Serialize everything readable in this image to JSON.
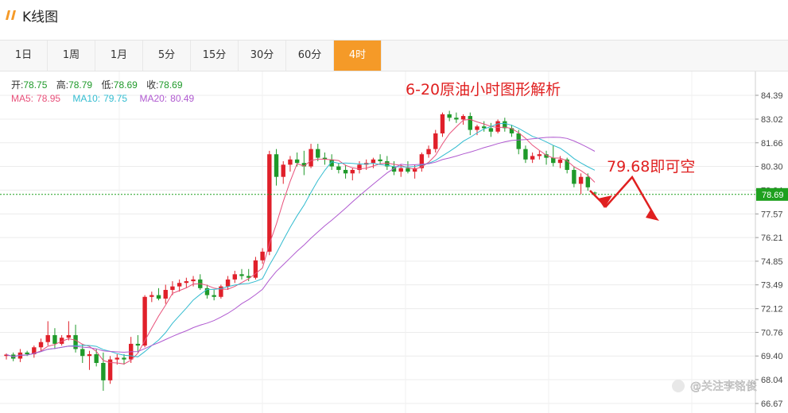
{
  "app": {
    "title": "K线图",
    "logo_icon": "orange-slash-bars-icon"
  },
  "tabs": [
    {
      "label": "1日",
      "active": false
    },
    {
      "label": "1周",
      "active": false
    },
    {
      "label": "1月",
      "active": false
    },
    {
      "label": "5分",
      "active": false
    },
    {
      "label": "15分",
      "active": false
    },
    {
      "label": "30分",
      "active": false
    },
    {
      "label": "60分",
      "active": false
    },
    {
      "label": "4时",
      "active": true
    }
  ],
  "colors": {
    "accent": "#f59a28",
    "up": "#e0202a",
    "down": "#1f9a2a",
    "ma5": "#e8507a",
    "ma10": "#33bcd0",
    "ma20": "#b05ad0",
    "annotation": "#e02020",
    "current_line": "#1fa01f"
  },
  "ohlc": {
    "open_label": "开:",
    "open": "78.75",
    "high_label": "高:",
    "high": "78.79",
    "low_label": "低:",
    "low": "78.69",
    "close_label": "收:",
    "close": "78.69"
  },
  "ma": {
    "ma5_label": "MA5:",
    "ma5": "78.95",
    "ma10_label": "MA10:",
    "ma10": "79.75",
    "ma20_label": "MA20:",
    "ma20": "80.49"
  },
  "annotations": {
    "headline": "6-20原油小时图形解析",
    "signal": "79.68即可空"
  },
  "watermark": "关注李铭俊",
  "chart_data": {
    "type": "candlestick",
    "current_price": 78.69,
    "current_price_label": "78.69",
    "y_ticks": [
      "84.39",
      "83.02",
      "81.66",
      "80.30",
      "78.94",
      "77.57",
      "76.21",
      "74.85",
      "73.49",
      "72.12",
      "70.76",
      "69.40",
      "68.04",
      "66.67"
    ],
    "ylim": [
      66.67,
      84.39
    ],
    "series_names": [
      "MA5",
      "MA10",
      "MA20"
    ],
    "candles": [
      [
        69.4,
        69.55,
        69.2,
        69.48
      ],
      [
        69.48,
        69.6,
        69.1,
        69.25
      ],
      [
        69.25,
        69.8,
        69.05,
        69.6
      ],
      [
        69.6,
        69.7,
        69.4,
        69.5
      ],
      [
        69.5,
        70.0,
        69.3,
        69.9
      ],
      [
        69.9,
        70.4,
        69.7,
        70.2
      ],
      [
        70.2,
        71.4,
        70.0,
        70.6
      ],
      [
        70.6,
        71.0,
        69.8,
        70.1
      ],
      [
        70.1,
        70.6,
        70.0,
        70.45
      ],
      [
        70.45,
        71.4,
        70.3,
        70.6
      ],
      [
        70.6,
        71.2,
        69.6,
        69.8
      ],
      [
        69.8,
        70.1,
        69.0,
        69.4
      ],
      [
        69.4,
        69.7,
        68.6,
        69.5
      ],
      [
        69.5,
        69.8,
        68.8,
        69.0
      ],
      [
        69.0,
        69.6,
        67.4,
        68.0
      ],
      [
        68.0,
        69.4,
        67.8,
        69.2
      ],
      [
        69.2,
        69.5,
        68.9,
        69.3
      ],
      [
        69.3,
        69.5,
        68.9,
        69.2
      ],
      [
        69.2,
        70.5,
        69.0,
        70.1
      ],
      [
        70.1,
        70.6,
        69.6,
        70.0
      ],
      [
        70.0,
        72.9,
        69.9,
        72.8
      ],
      [
        72.8,
        73.1,
        72.5,
        72.9
      ],
      [
        72.9,
        73.3,
        72.6,
        72.7
      ],
      [
        72.7,
        73.5,
        72.4,
        73.2
      ],
      [
        73.2,
        73.7,
        72.9,
        73.4
      ],
      [
        73.4,
        73.8,
        73.1,
        73.6
      ],
      [
        73.6,
        73.9,
        73.3,
        73.7
      ],
      [
        73.7,
        74.0,
        73.4,
        73.8
      ],
      [
        73.8,
        74.1,
        73.2,
        73.3
      ],
      [
        73.3,
        73.5,
        72.7,
        72.9
      ],
      [
        72.9,
        73.2,
        72.6,
        72.8
      ],
      [
        72.8,
        73.5,
        72.7,
        73.4
      ],
      [
        73.4,
        74.0,
        73.2,
        73.8
      ],
      [
        73.8,
        74.3,
        73.6,
        74.1
      ],
      [
        74.1,
        74.4,
        73.8,
        74.0
      ],
      [
        74.0,
        74.4,
        73.7,
        73.9
      ],
      [
        73.9,
        75.1,
        73.8,
        74.9
      ],
      [
        74.9,
        75.6,
        74.7,
        75.4
      ],
      [
        75.4,
        81.2,
        75.2,
        81.0
      ],
      [
        81.0,
        81.3,
        79.2,
        79.7
      ],
      [
        79.7,
        80.6,
        79.3,
        80.4
      ],
      [
        80.4,
        80.9,
        80.0,
        80.7
      ],
      [
        80.7,
        81.1,
        80.3,
        80.5
      ],
      [
        80.5,
        81.2,
        79.8,
        80.3
      ],
      [
        80.3,
        81.6,
        80.2,
        81.3
      ],
      [
        81.3,
        81.6,
        80.6,
        80.8
      ],
      [
        80.8,
        81.1,
        80.4,
        80.7
      ],
      [
        80.7,
        81.0,
        80.1,
        80.3
      ],
      [
        80.3,
        80.5,
        79.9,
        80.1
      ],
      [
        80.1,
        80.4,
        79.6,
        79.9
      ],
      [
        79.9,
        80.2,
        79.5,
        80.1
      ],
      [
        80.1,
        80.6,
        79.9,
        80.4
      ],
      [
        80.4,
        80.7,
        80.1,
        80.5
      ],
      [
        80.5,
        80.8,
        80.2,
        80.7
      ],
      [
        80.7,
        81.0,
        80.4,
        80.6
      ],
      [
        80.6,
        80.9,
        80.1,
        80.3
      ],
      [
        80.3,
        80.6,
        79.8,
        80.0
      ],
      [
        80.0,
        80.4,
        79.7,
        80.2
      ],
      [
        80.2,
        80.6,
        79.9,
        80.0
      ],
      [
        80.0,
        80.4,
        79.6,
        80.2
      ],
      [
        80.2,
        81.1,
        80.0,
        81.0
      ],
      [
        81.0,
        81.5,
        80.8,
        81.3
      ],
      [
        81.3,
        82.4,
        81.1,
        82.2
      ],
      [
        82.2,
        83.4,
        82.0,
        83.3
      ],
      [
        83.3,
        83.5,
        82.9,
        83.1
      ],
      [
        83.1,
        83.4,
        82.8,
        83.0
      ],
      [
        83.0,
        83.3,
        82.7,
        83.2
      ],
      [
        83.2,
        83.4,
        82.1,
        82.4
      ],
      [
        82.4,
        82.7,
        82.1,
        82.6
      ],
      [
        82.6,
        82.9,
        82.3,
        82.5
      ],
      [
        82.5,
        82.8,
        82.0,
        82.3
      ],
      [
        82.3,
        83.0,
        82.2,
        82.9
      ],
      [
        82.9,
        83.1,
        82.3,
        82.5
      ],
      [
        82.5,
        82.7,
        82.0,
        82.2
      ],
      [
        82.2,
        82.4,
        81.0,
        81.3
      ],
      [
        81.3,
        81.5,
        80.5,
        80.7
      ],
      [
        80.7,
        81.1,
        80.5,
        80.9
      ],
      [
        80.9,
        81.2,
        80.7,
        81.0
      ],
      [
        81.0,
        81.2,
        80.4,
        80.8
      ],
      [
        80.8,
        81.5,
        80.3,
        80.5
      ],
      [
        80.5,
        80.9,
        80.2,
        80.7
      ],
      [
        80.7,
        80.8,
        79.9,
        80.1
      ],
      [
        80.1,
        80.3,
        79.1,
        79.3
      ],
      [
        79.3,
        79.9,
        78.7,
        79.7
      ],
      [
        79.7,
        79.9,
        78.9,
        79.1
      ],
      [
        78.8,
        78.85,
        78.69,
        78.75
      ]
    ]
  }
}
